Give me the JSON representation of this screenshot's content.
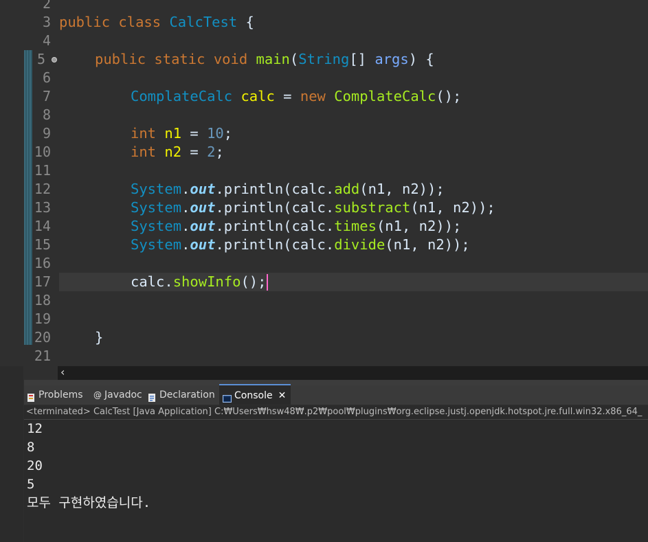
{
  "editor": {
    "line_numbers": [
      "2",
      "3",
      "4",
      "5",
      "6",
      "7",
      "8",
      "9",
      "10",
      "11",
      "12",
      "13",
      "14",
      "15",
      "16",
      "17",
      "18",
      "19",
      "20",
      "21"
    ],
    "code": {
      "l3": {
        "kw1": "public",
        "kw2": "class",
        "name": "CalcTest",
        "brace": " {"
      },
      "l5": {
        "kw1": "public",
        "kw2": "static",
        "kw3": "void",
        "method": "main",
        "p1": "(",
        "type": "String",
        "p2": "[] ",
        "param": "args",
        "p3": ") {"
      },
      "l7": {
        "type1": "ComplateCalc",
        "var": "calc",
        "eq": " = ",
        "kw": "new",
        "ctor": "ComplateCalc",
        "end": "();"
      },
      "l9": {
        "kw": "int",
        "var": "n1",
        "eq": " = ",
        "num": "10",
        "end": ";"
      },
      "l10": {
        "kw": "int",
        "var": "n2",
        "eq": " = ",
        "num": "2",
        "end": ";"
      },
      "l12": {
        "sys": "System",
        "dot1": ".",
        "out": "out",
        "rest1": ".println(calc.",
        "meth": "add",
        "rest2": "(n1, n2));"
      },
      "l13": {
        "sys": "System",
        "dot1": ".",
        "out": "out",
        "rest1": ".println(calc.",
        "meth": "substract",
        "rest2": "(n1, n2));"
      },
      "l14": {
        "sys": "System",
        "dot1": ".",
        "out": "out",
        "rest1": ".println(calc.",
        "meth": "times",
        "rest2": "(n1, n2));"
      },
      "l15": {
        "sys": "System",
        "dot1": ".",
        "out": "out",
        "rest1": ".println(calc.",
        "meth": "divide",
        "rest2": "(n1, n2));"
      },
      "l17": {
        "obj": "calc.",
        "meth": "showInfo",
        "end": "();"
      },
      "l20": {
        "brace": "}"
      }
    },
    "scroll_left_icon": "‹"
  },
  "panel": {
    "tabs": [
      {
        "label": "Problems",
        "icon": "problems-icon"
      },
      {
        "label": "Javadoc",
        "icon": "javadoc-icon"
      },
      {
        "label": "Declaration",
        "icon": "declaration-icon"
      },
      {
        "label": "Console",
        "icon": "console-icon",
        "active": true
      }
    ],
    "close_label": "✕",
    "terminated_text": "<terminated> CalcTest [Java Application] C:₩Users₩hsw48₩.p2₩pool₩plugins₩org.eclipse.justj.openjdk.hotspot.jre.full.win32.x86_64_",
    "output": [
      "12",
      "8",
      "20",
      "5",
      "모두 구현하였습니다."
    ]
  },
  "colors": {
    "keyword": "#cc7832",
    "type": "#1290c3",
    "variable": "#f2f200",
    "number": "#6897bb",
    "method": "#a7ec21",
    "field": "#8dd4ff",
    "background": "#2f2f2f"
  }
}
